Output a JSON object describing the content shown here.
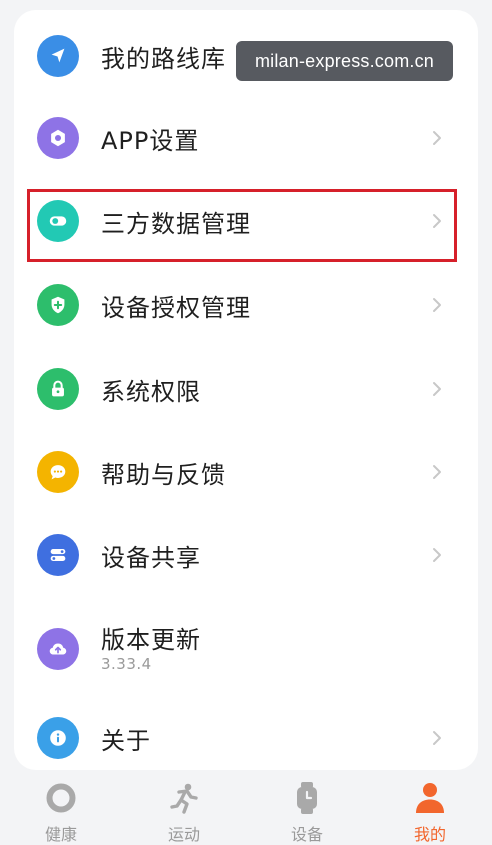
{
  "watermark": "milan-express.com.cn",
  "menu": {
    "items": [
      {
        "label": "我的路线库",
        "icon": "navigation-arrow-icon",
        "color": "#3a8ee6"
      },
      {
        "label": "APP设置",
        "icon": "settings-hexagon-icon",
        "color": "#8e73e6"
      },
      {
        "label": "三方数据管理",
        "icon": "toggle-icon",
        "color": "#22c9b4"
      },
      {
        "label": "设备授权管理",
        "icon": "shield-plus-icon",
        "color": "#2dbe6c"
      },
      {
        "label": "系统权限",
        "icon": "lock-icon",
        "color": "#2dbe6c"
      },
      {
        "label": "帮助与反馈",
        "icon": "chat-bubble-icon",
        "color": "#f4b400"
      },
      {
        "label": "设备共享",
        "icon": "share-toggles-icon",
        "color": "#3f6fe0"
      },
      {
        "label": "版本更新",
        "sub": "3.33.4",
        "icon": "cloud-upload-icon",
        "color": "#8e73e6"
      },
      {
        "label": "关于",
        "icon": "info-icon",
        "color": "#3aa0e8"
      }
    ]
  },
  "tabs": [
    {
      "label": "健康",
      "icon": "ring-icon"
    },
    {
      "label": "运动",
      "icon": "running-person-icon"
    },
    {
      "label": "设备",
      "icon": "watch-icon"
    },
    {
      "label": "我的",
      "icon": "person-icon",
      "active": true
    }
  ],
  "colors": {
    "accent": "#f2662d",
    "highlight_border": "#d6202a"
  }
}
